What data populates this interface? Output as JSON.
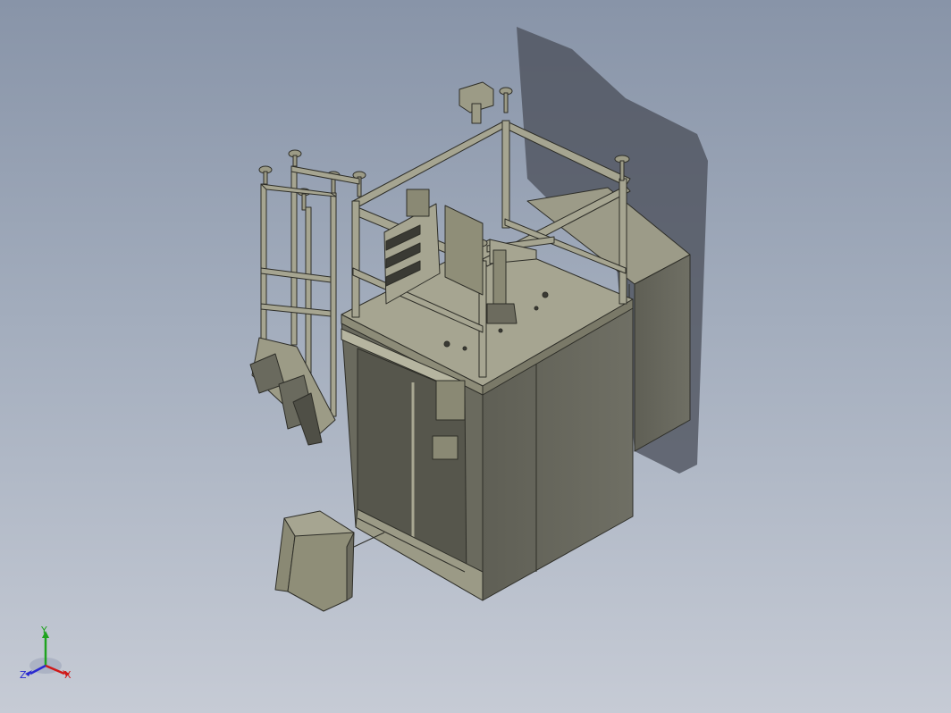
{
  "viewport": {
    "background_top": "#8894a8",
    "background_bottom": "#c6cbd5",
    "model_color": "#8f8e78",
    "edge_color": "#2e2e28"
  },
  "triad": {
    "y_label": "Y",
    "x_label": "X",
    "z_label": "Z",
    "x_color": "#d01818",
    "y_color": "#1fa31f",
    "z_color": "#2a2ad0"
  }
}
